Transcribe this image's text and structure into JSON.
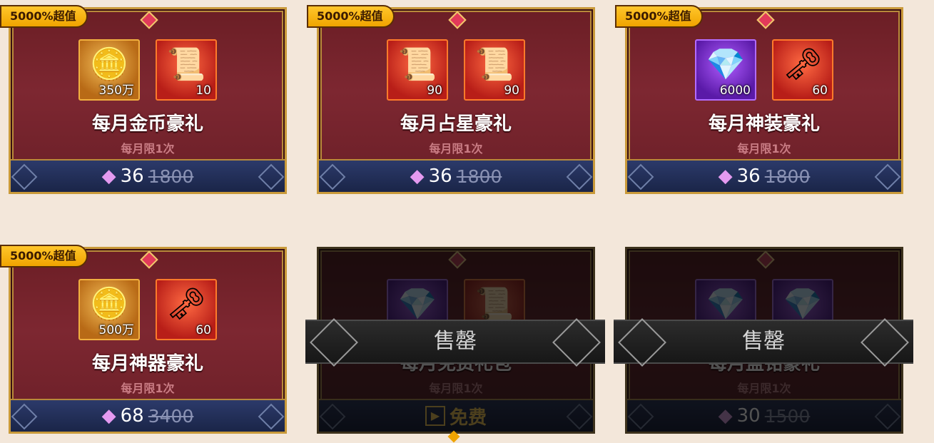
{
  "cards": [
    {
      "badge": "5000%超值",
      "title": "每月金币豪礼",
      "limit": "每月限1次",
      "price": "36",
      "original_price": "1800",
      "items": [
        {
          "type": "gold-coin",
          "icon": "coin-icon",
          "quantity": "350万"
        },
        {
          "type": "astrology-scroll",
          "icon": "scroll-icon",
          "quantity": "10"
        }
      ]
    },
    {
      "badge": "5000%超值",
      "title": "每月占星豪礼",
      "limit": "每月限1次",
      "price": "36",
      "original_price": "1800",
      "items": [
        {
          "type": "astrology-scroll",
          "icon": "scroll-icon",
          "quantity": "90"
        },
        {
          "type": "astrology-scroll",
          "icon": "scroll-icon",
          "quantity": "90"
        }
      ]
    },
    {
      "badge": "5000%超值",
      "title": "每月神装豪礼",
      "limit": "每月限1次",
      "price": "36",
      "original_price": "1800",
      "items": [
        {
          "type": "crystal-shard",
          "icon": "crystal-icon",
          "quantity": "6000"
        },
        {
          "type": "golden-key",
          "icon": "key-icon",
          "quantity": "60"
        }
      ]
    },
    {
      "badge": "5000%超值",
      "title": "每月神器豪礼",
      "limit": "每月限1次",
      "price": "68",
      "original_price": "3400",
      "items": [
        {
          "type": "gold-coin",
          "icon": "coin-icon",
          "quantity": "500万"
        },
        {
          "type": "artifact-key",
          "icon": "key-icon",
          "quantity": "60"
        }
      ]
    },
    {
      "title": "每月免费礼包",
      "limit": "每月限1次",
      "free_label": "免费",
      "sold_out": "售罄",
      "items": [
        {
          "type": "crystal-shard",
          "icon": "crystal-icon"
        },
        {
          "type": "astrology-scroll",
          "icon": "scroll-icon"
        }
      ]
    },
    {
      "title": "每月盖铭豪礼",
      "limit": "每月限1次",
      "price": "30",
      "original_price": "1500",
      "sold_out": "售罄",
      "items": [
        {
          "type": "crystal-shard",
          "icon": "crystal-icon"
        },
        {
          "type": "crystal-shard",
          "icon": "crystal-icon"
        }
      ]
    }
  ],
  "colors": {
    "badge": "#ffc62b",
    "card_bg": "#7d2731",
    "price_bar": "#2c3a6a",
    "page_bg": "#f3e7da"
  }
}
